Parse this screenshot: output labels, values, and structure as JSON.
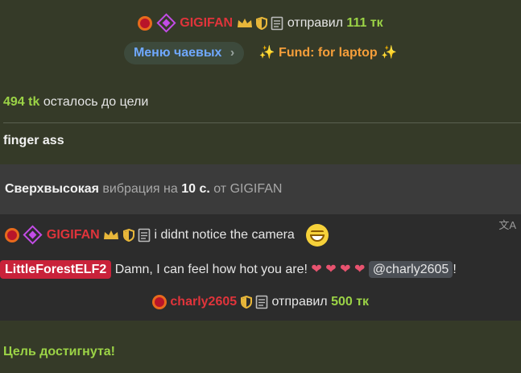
{
  "tip1": {
    "username": "GIGIFAN",
    "action": "отправил",
    "amount": "111 тк"
  },
  "menu": {
    "tip_menu_label": "Меню чаевых",
    "fund_label": "✨ Fund: for laptop ✨"
  },
  "goal": {
    "remaining": "494 tk",
    "remaining_text": "осталось до цели"
  },
  "topic": {
    "text": "finger ass"
  },
  "vibe": {
    "level": "Сверхвысокая",
    "mid": "вибрация на",
    "duration": "10 с.",
    "from": "от",
    "user": "GIGIFAN"
  },
  "msg1": {
    "username": "GIGIFAN",
    "text": "i didnt notice the camera"
  },
  "msg2": {
    "username": "LittleForestELF2",
    "text": "Damn, I can feel how hot you are!",
    "mention": "@charly2605",
    "trail": "!"
  },
  "tip2": {
    "username": "charly2605",
    "action": "отправил",
    "amount": "500 тк"
  },
  "goal_reached": {
    "text": "Цель достигнута!"
  },
  "icons": [
    "star-badge-icon",
    "diamond-icon",
    "crown-icon",
    "shield-icon",
    "document-icon",
    "chevron-right-icon",
    "translate-icon",
    "smiley-icon",
    "heart-icon"
  ],
  "colors": {
    "background": "#353a28",
    "green": "#9bd346",
    "red": "#e0343b",
    "link": "#6fa8ff",
    "fund": "#f59e3a"
  }
}
